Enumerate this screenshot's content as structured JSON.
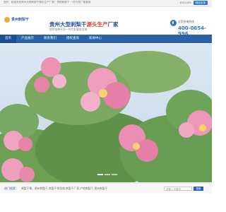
{
  "topbar": {
    "left_text": "您好，欢迎来到贵州大型刺梨干源头生产厂家！贵阳刺梨干 一件代发厂家直销",
    "lang_en": "ENGLISH",
    "online_label": "网站目录"
  },
  "header": {
    "logo_text": "贵州刺梨干",
    "title_main": "贵州大型刺梨干",
    "title_red": "源头生产",
    "title_tail": "厂家",
    "subtitle": "提供各种平台一件代发服务支持",
    "hotline_label": "全国咨询热线",
    "hotline_number": "400-0654-996"
  },
  "nav": [
    {
      "label": "首页"
    },
    {
      "label": "产品展示"
    },
    {
      "label": "联系我们"
    },
    {
      "label": "授权查询"
    },
    {
      "label": "新闻中心"
    }
  ],
  "search": {
    "label": "热门搜索：",
    "keywords": "刺梨干果，贵州刺梨干,刺梨干的功效,刺梨干厂家,产地刺梨干,贵州刺梨干",
    "placeholder": "请输入关键词",
    "button": "搜索"
  },
  "colors": {
    "primary_blue": "#2962a9",
    "accent_red": "#e33d2e",
    "phone_blue": "#2f77c6"
  }
}
